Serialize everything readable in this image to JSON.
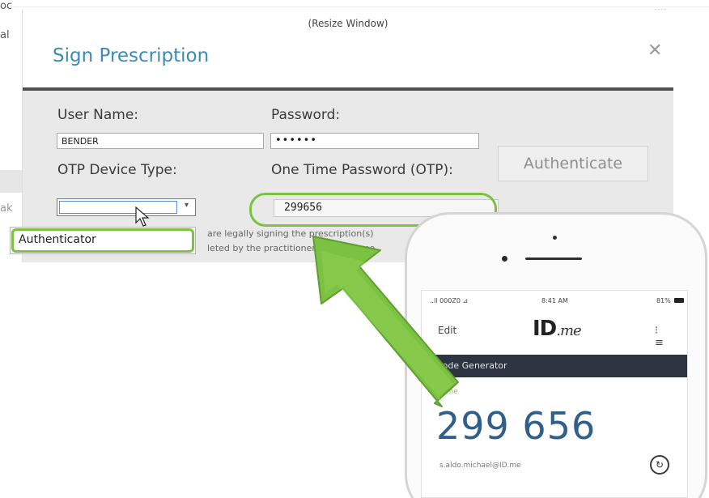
{
  "background": {
    "frag_oc": "oc",
    "frag_al": "al",
    "frag_ak": "ak",
    "right_frag": "...."
  },
  "dialog": {
    "resize_label": "(Resize Window)",
    "title": "Sign Prescription",
    "close_glyph": "✕",
    "user_name_label": "User Name:",
    "user_name_value": "BENDER",
    "password_label": "Password:",
    "password_value": "••••••",
    "otp_device_type_label": "OTP Device Type:",
    "otp_label": "One Time Password (OTP):",
    "otp_value": "299656",
    "authenticate_label": "Authenticate",
    "device_select_value": "",
    "dropdown_options": [
      "Authenticator"
    ],
    "notice_line1": "are legally signing the prescription(s)",
    "notice_line2": "leted by the practitioner whose name"
  },
  "phone": {
    "status_left": "..ll 000Z0 ⊿",
    "status_center": "8:41 AM",
    "status_right": "81%",
    "edit_label": "Edit",
    "brand_main": "ID",
    "brand_sub": ".me",
    "nav_icons": "⁝ ≡",
    "section_label": "Code Generator",
    "code_label": "ID.me",
    "code_value": "299 656",
    "account_email": "s.aldo.michael@ID.me",
    "refresh_icon": "↻"
  },
  "colors": {
    "accent_green": "#7cc242",
    "title_blue": "#3d8ab3",
    "code_blue": "#2f5f8a"
  }
}
